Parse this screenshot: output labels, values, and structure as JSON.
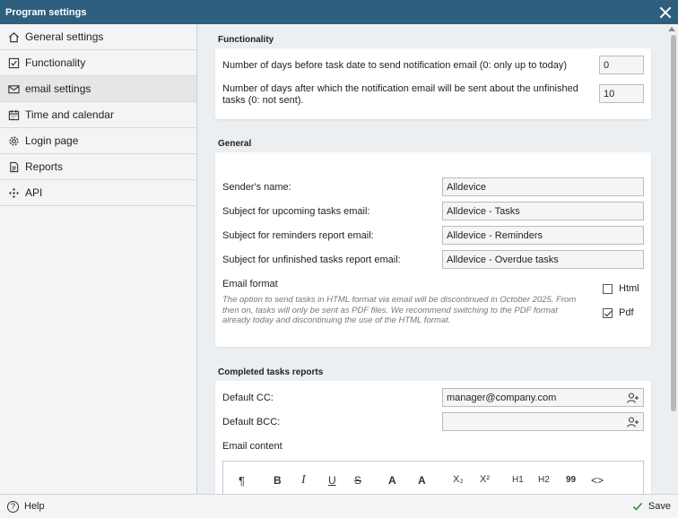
{
  "window": {
    "title": "Program settings"
  },
  "sidebar": {
    "items": [
      {
        "label": "General settings",
        "icon": "home-icon"
      },
      {
        "label": "Functionality",
        "icon": "checkbox-icon"
      },
      {
        "label": "email settings",
        "icon": "envelope-icon"
      },
      {
        "label": "Time and calendar",
        "icon": "calendar-icon"
      },
      {
        "label": "Login page",
        "icon": "gear-icon"
      },
      {
        "label": "Reports",
        "icon": "document-icon"
      },
      {
        "label": "API",
        "icon": "move-arrows-icon"
      }
    ]
  },
  "functionality": {
    "title": "Functionality",
    "days_before_label": "Number of days before task date to send notification email (0: only up to today)",
    "days_before_value": "0",
    "days_after_label": "Number of days after which the notification email will be sent about the unfinished tasks (0: not sent).",
    "days_after_value": "10"
  },
  "general": {
    "title": "General",
    "sender_label": "Sender's name:",
    "sender_value": "Alldevice",
    "upcoming_label": "Subject for upcoming tasks email:",
    "upcoming_value": "Alldevice - Tasks",
    "reminders_label": "Subject for reminders report email:",
    "reminders_value": "Alldevice - Reminders",
    "unfinished_label": "Subject for unfinished tasks report email:",
    "unfinished_value": "Alldevice - Overdue tasks",
    "format_label": "Email format",
    "format_hint": "The option to send tasks in HTML format via email will be discontinued in October 2025. From then on, tasks will only be sent as PDF files. We recommend switching to the PDF format already today and discontinuing the use of the HTML format.",
    "html_label": "Html",
    "html_checked": false,
    "pdf_label": "Pdf",
    "pdf_checked": true
  },
  "completed": {
    "title": "Completed tasks reports",
    "cc_label": "Default CC:",
    "cc_value": "manager@company.com",
    "bcc_label": "Default BCC:",
    "bcc_value": "",
    "content_label": "Email content"
  },
  "editor_toolbar": {
    "paragraph": "¶",
    "bold": "B",
    "italic": "I",
    "underline": "U",
    "strike": "S",
    "font_color": "A",
    "bg_color": "A",
    "subscript": "X₂",
    "superscript": "X²",
    "h1": "H1",
    "h2": "H2",
    "quote": "99",
    "code": "<>"
  },
  "footer": {
    "help_label": "Help",
    "save_label": "Save"
  },
  "colors": {
    "titlebar": "#2e5f7e",
    "accent_green": "#3a8a3a"
  }
}
